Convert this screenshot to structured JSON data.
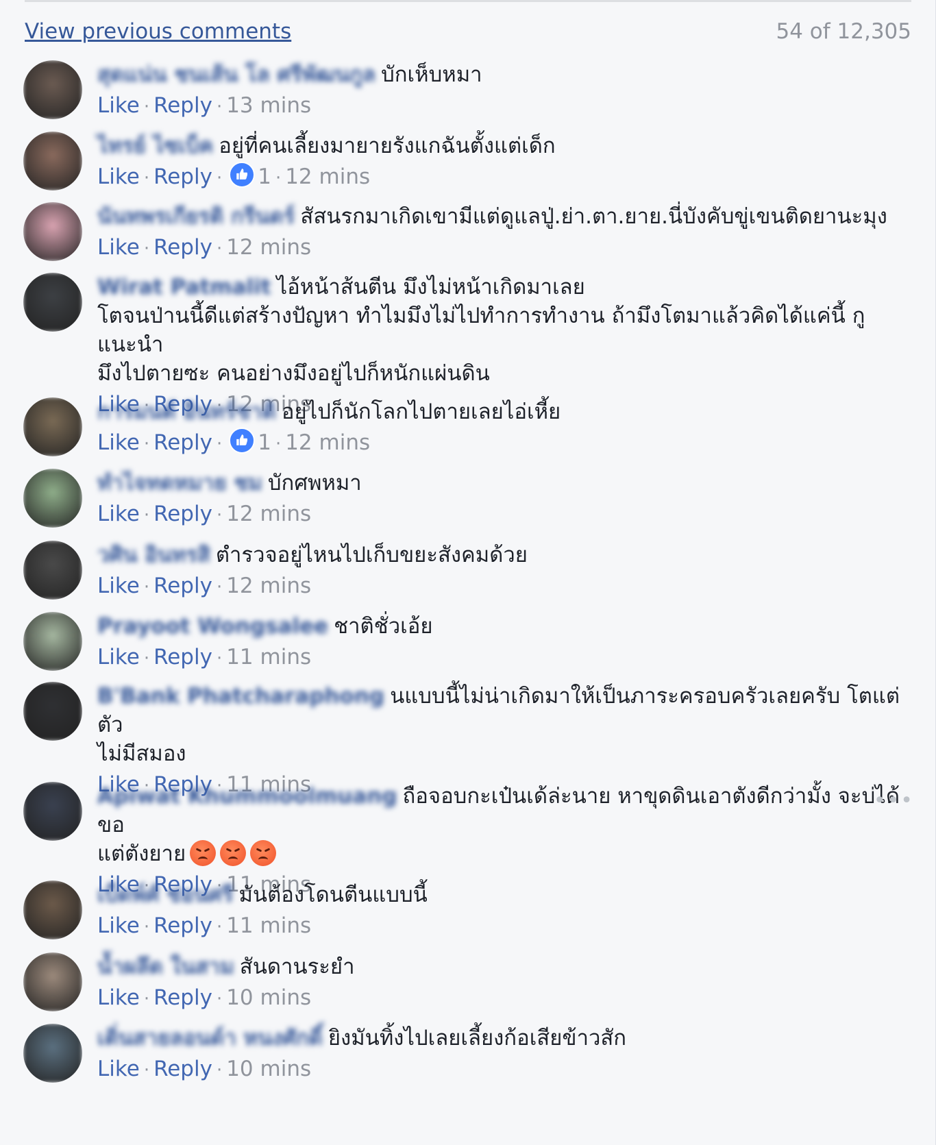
{
  "header": {
    "view_previous": "View previous comments",
    "count": "54 of 12,305"
  },
  "actions": {
    "like": "Like",
    "reply": "Reply"
  },
  "comments": [
    {
      "name": "สุดแน่น ชนเส้น โล ศรีพัฒนกูล",
      "text": "บักเห็บหมา",
      "time": "13 mins",
      "likes": "",
      "avatar": "#6b5b52"
    },
    {
      "name": "ไทรย์ ไซเบ็ค",
      "text": "อยู่ที่คนเลี้ยงมายายรังแกฉันตั้งแต่เด็ก",
      "time": "12 mins",
      "likes": "1",
      "avatar": "#8a6a5d"
    },
    {
      "name": "นันทพรเกียรติ กรีนดร์",
      "text": "สัสนรกมาเกิดเขามีแต่ดูแลปู่.ย่า.ตา.ยาย.นี่บังคับขู่เขนติดยานะมุง",
      "time": "12 mins",
      "likes": "",
      "avatar": "#d9a3b1"
    },
    {
      "name": "Wirat Patmalit",
      "text": "ไอ้หน้าส้นตีน มึงไม่หน้าเกิดมาเลย\nโตจนป่านนี้ดีแต่สร้างปัญหา ทำไมมึงไม่ไปทำการทำงาน ถ้ามึงโตมาแล้วคิดได้แค่นี้ กูแนะนำ\nมึงไปตายซะ คนอย่างมึงอยู่ไปก็หนักแผ่นดิน",
      "time": "12 mins",
      "likes": "",
      "avatar": "#3d4044"
    },
    {
      "name": "การมนต์ อินทร์ชาติ",
      "text": "อยู่ไปก็นักโลกไปตายเลยไอ่เหี้ย",
      "time": "12 mins",
      "likes": "1",
      "avatar": "#7a6a55"
    },
    {
      "name": "ทำไจทดหมาย ชม",
      "text": "บักศพหมา",
      "time": "12 mins",
      "likes": "",
      "avatar": "#8fae8a"
    },
    {
      "name": "วศิน อินทรสิ",
      "text": "ตำรวจอยู่ไหนไปเก็บขยะสังคมด้วย",
      "time": "12 mins",
      "likes": "",
      "avatar": "#4a4a4a"
    },
    {
      "name": "Prayoot Wongsalee",
      "text": "ชาติชั่วเอ้ย",
      "time": "11 mins",
      "likes": "",
      "avatar": "#a5b7a0"
    },
    {
      "name": "B'Bank Phatcharaphong",
      "text": "นแบบนี้ไม่น่าเกิดมาให้เป็นภาระครอบครัวเลยครับ โตแต่ตัว\nไม่มีสมอง",
      "time": "11 mins",
      "likes": "",
      "avatar": "#2f3033"
    },
    {
      "name": "Apiwat Khummoolmuang",
      "text": "ถือจอบกะเป๋นเด้ล่ะนาย หาขุดดินเอาตังดีกว่ามั้ง จะบ่ได้ขอ\nแต่ตังยาย",
      "time": "11 mins",
      "likes": "",
      "avatar": "#3a4150",
      "emoji": 3,
      "more": "•••"
    },
    {
      "name": "เบ็ดพ์ศ์ ช่อนศรี",
      "text": "มันต้องโดนตีนแบบนี้",
      "time": "11 mins",
      "likes": "",
      "avatar": "#6c5a4a"
    },
    {
      "name": "น้ำผลึด ในสาม",
      "text": "สันดานระยำ",
      "time": "10 mins",
      "likes": "",
      "avatar": "#9c8a7c"
    },
    {
      "name": "เติ่นสายลอนด์า หนงศักดิ์",
      "text": "ยิงมันทิ้งไปเลยเลี้ยงก้อเสียข้าวสัก",
      "time": "10 mins",
      "likes": "",
      "avatar": "#5b7080"
    }
  ]
}
